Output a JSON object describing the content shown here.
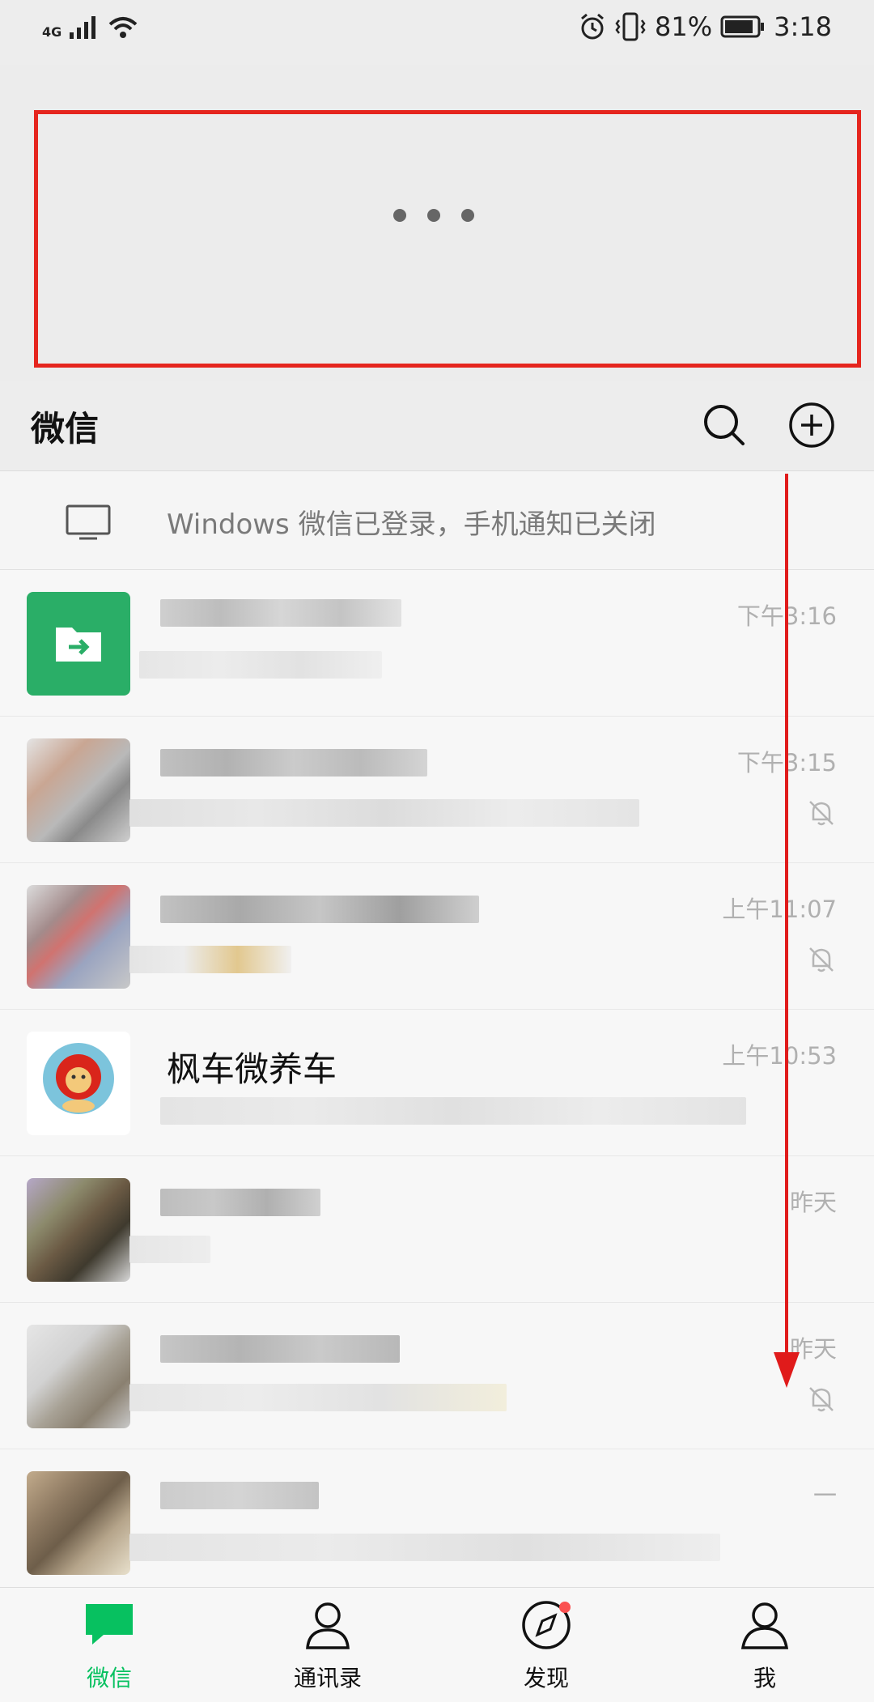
{
  "status_bar": {
    "network": "4G",
    "battery_percent": "81%",
    "time": "3:18",
    "icons": [
      "signal-icon",
      "wifi-icon",
      "alarm-icon",
      "vibrate-icon",
      "battery-icon"
    ]
  },
  "header": {
    "title": "微信",
    "search_icon": "search-icon",
    "add_icon": "plus-circle-icon"
  },
  "notice": {
    "icon": "monitor-icon",
    "text": "Windows 微信已登录，手机通知已关闭"
  },
  "chats": [
    {
      "name": "",
      "time": "下午3:16",
      "muted": false,
      "avatar": "file-transfer-icon"
    },
    {
      "name": "",
      "time": "下午3:15",
      "muted": true,
      "avatar": "group-avatar"
    },
    {
      "name": "",
      "time": "上午11:07",
      "muted": true,
      "avatar": "group-avatar"
    },
    {
      "name": "枫车微养车",
      "time": "上午10:53",
      "muted": false,
      "avatar": "lion-logo"
    },
    {
      "name": "",
      "time": "昨天",
      "muted": false,
      "avatar": "group-avatar"
    },
    {
      "name": "",
      "time": "昨天",
      "muted": true,
      "avatar": "group-avatar"
    },
    {
      "name": "",
      "time": "一",
      "muted": false,
      "avatar": "group-avatar"
    }
  ],
  "tabs": [
    {
      "label": "微信",
      "icon": "chat-bubble-icon",
      "active": true
    },
    {
      "label": "通讯录",
      "icon": "contacts-icon",
      "active": false
    },
    {
      "label": "发现",
      "icon": "compass-icon",
      "active": false
    },
    {
      "label": "我",
      "icon": "person-icon",
      "active": false
    }
  ],
  "colors": {
    "accent": "#07c160",
    "highlight_box": "#e5251e",
    "arrow": "#e01b1b",
    "file_transfer": "#2aae67"
  }
}
